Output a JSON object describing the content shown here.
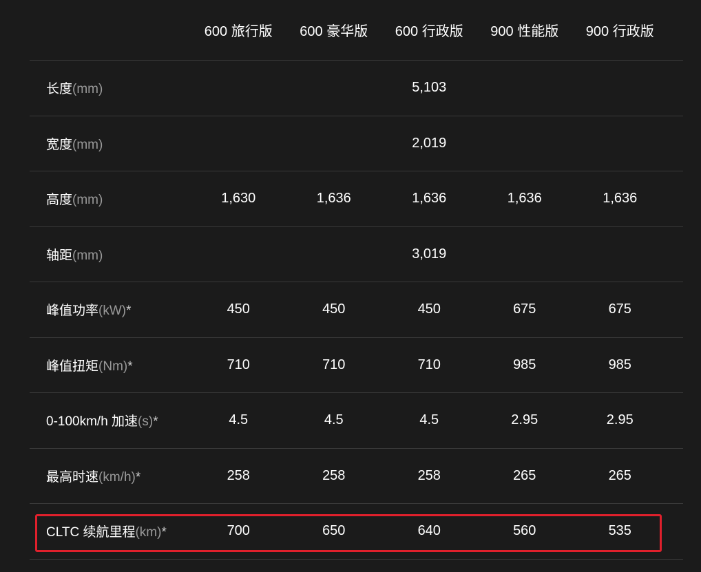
{
  "header": {
    "columns": [
      "600 旅行版",
      "600 豪华版",
      "600 行政版",
      "900 性能版",
      "900 行政版"
    ]
  },
  "rows": [
    {
      "label": "长度",
      "unit": "(mm)",
      "star": "",
      "span": "5,103"
    },
    {
      "label": "宽度",
      "unit": "(mm)",
      "star": "",
      "span": "2,019"
    },
    {
      "label": "高度",
      "unit": "(mm)",
      "star": "",
      "values": [
        "1,630",
        "1,636",
        "1,636",
        "1,636",
        "1,636"
      ]
    },
    {
      "label": "轴距",
      "unit": "(mm)",
      "star": "",
      "span": "3,019"
    },
    {
      "label": "峰值功率",
      "unit": "(kW)",
      "star": "*",
      "values": [
        "450",
        "450",
        "450",
        "675",
        "675"
      ]
    },
    {
      "label": "峰值扭矩",
      "unit": "(Nm)",
      "star": "*",
      "values": [
        "710",
        "710",
        "710",
        "985",
        "985"
      ]
    },
    {
      "label": "0-100km/h 加速",
      "unit": "(s)",
      "star": "*",
      "values": [
        "4.5",
        "4.5",
        "4.5",
        "2.95",
        "2.95"
      ]
    },
    {
      "label": "最高时速",
      "unit": "(km/h)",
      "star": "*",
      "values": [
        "258",
        "258",
        "258",
        "265",
        "265"
      ]
    },
    {
      "label": "CLTC 续航里程",
      "unit": "(km)",
      "star": "*",
      "values": [
        "700",
        "650",
        "640",
        "560",
        "535"
      ]
    }
  ],
  "colors": {
    "background": "#1b1b1b",
    "divider": "#3a3a3a",
    "unit_text": "#9a9a9a",
    "highlight": "#e0202c"
  }
}
